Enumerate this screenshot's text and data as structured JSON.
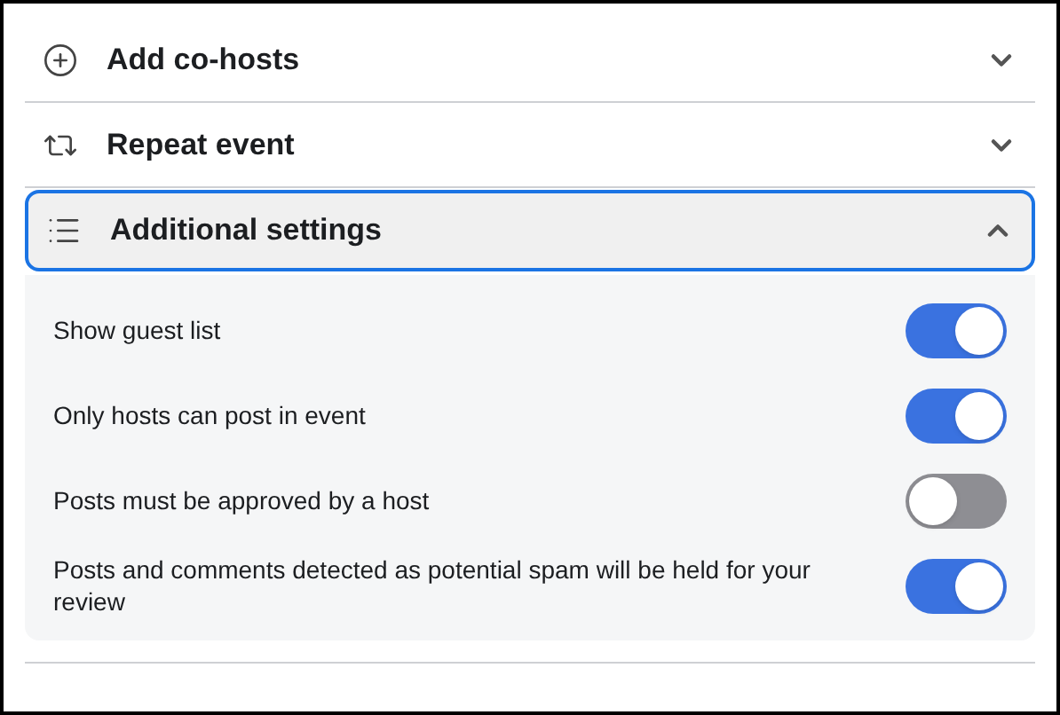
{
  "sections": [
    {
      "title": "Add co-hosts",
      "expanded": false
    },
    {
      "title": "Repeat event",
      "expanded": false
    },
    {
      "title": "Additional settings",
      "expanded": true
    }
  ],
  "settings": [
    {
      "label": "Show guest list",
      "on": true
    },
    {
      "label": "Only hosts can post in event",
      "on": true
    },
    {
      "label": "Posts must be approved by a host",
      "on": false
    },
    {
      "label": "Posts and comments detected as potential spam will be held for your review",
      "on": true
    }
  ]
}
